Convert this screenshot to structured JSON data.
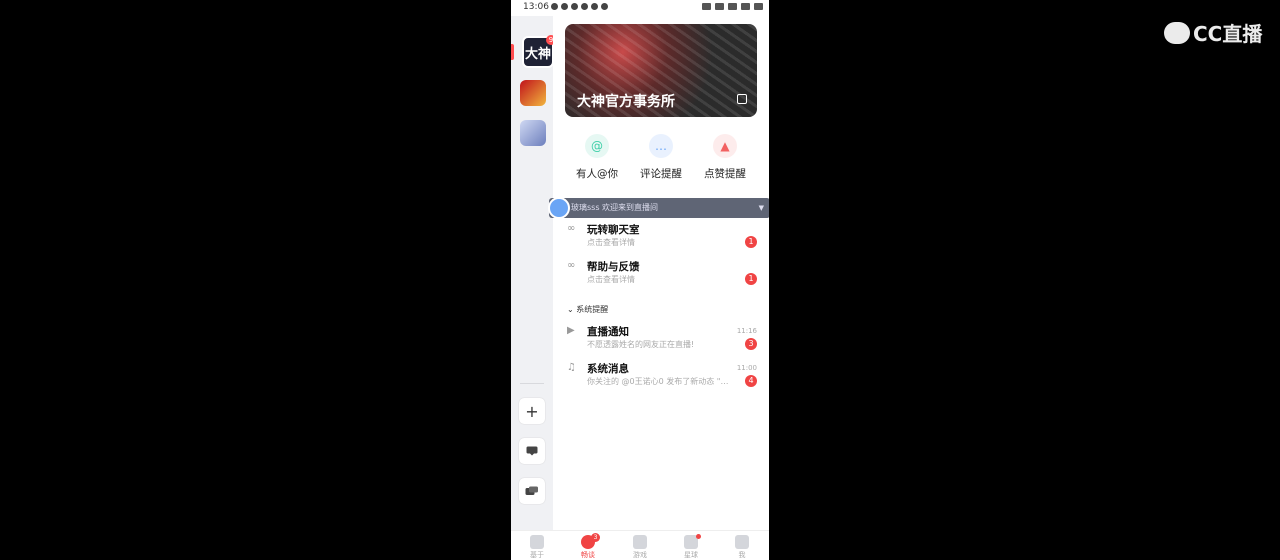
{
  "status_bar": {
    "time": "13:06"
  },
  "sidebar": {
    "games": [
      {
        "label": "大神",
        "badge": "9"
      }
    ]
  },
  "banner": {
    "title": "大神官方事务所"
  },
  "quick_actions": [
    {
      "label": "有人@你",
      "icon": "at-icon",
      "color": "#3ecfa8"
    },
    {
      "label": "评论提醒",
      "icon": "comment-icon",
      "color": "#6aa6f8"
    },
    {
      "label": "点赞提醒",
      "icon": "thumb-up-icon",
      "color": "#f26161"
    }
  ],
  "toast": {
    "text": "玻璃sss 欢迎来到直播间"
  },
  "messages": [
    {
      "title": "玩转聊天室",
      "subtitle": "点击查看详情",
      "badge": "1",
      "icon": "link-icon"
    },
    {
      "title": "帮助与反馈",
      "subtitle": "点击查看详情",
      "badge": "1",
      "icon": "link-icon"
    }
  ],
  "section": {
    "label": "系统提醒"
  },
  "notifications": [
    {
      "title": "直播通知",
      "subtitle": "不愿透露姓名的网友正在直播!",
      "time": "11:16",
      "badge": "3",
      "icon": "play-icon"
    },
    {
      "title": "系统消息",
      "subtitle": "你关注的 @0王诺心0 发布了新动态 \"…",
      "time": "11:00",
      "badge": "4",
      "icon": "bell-icon"
    }
  ],
  "tabbar": [
    {
      "label": "基于"
    },
    {
      "label": "畅谈",
      "badge": "3"
    },
    {
      "label": "游戏"
    },
    {
      "label": "星球"
    },
    {
      "label": "我"
    }
  ],
  "watermark": {
    "text": "CC直播"
  },
  "colors": {
    "accent": "#f04444",
    "toast_bg": "#5f6575"
  }
}
